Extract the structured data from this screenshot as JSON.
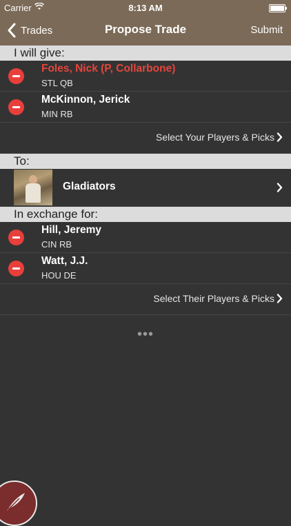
{
  "status": {
    "carrier": "Carrier",
    "time": "8:13 AM"
  },
  "nav": {
    "back_label": "Trades",
    "title": "Propose Trade",
    "submit_label": "Submit"
  },
  "give": {
    "header": "I will give:",
    "players": [
      {
        "name": "Foles, Nick (P, Collarbone)",
        "team": "STL QB",
        "injured": true
      },
      {
        "name": "McKinnon, Jerick",
        "team": "MIN RB",
        "injured": false
      }
    ],
    "select_label": "Select Your Players & Picks"
  },
  "to": {
    "header": "To:",
    "team_name": "Gladiators"
  },
  "exchange": {
    "header": "In exchange for:",
    "players": [
      {
        "name": "Hill, Jeremy",
        "team": "CIN RB"
      },
      {
        "name": "Watt, J.J.",
        "team": "HOU DE"
      }
    ],
    "select_label": "Select Their Players & Picks"
  },
  "more": "•••",
  "colors": {
    "nav_bg": "#7b6a57",
    "body_bg": "#333333",
    "remove": "#e93f3b",
    "injured": "#e6453c",
    "header_bg": "#dcdcdc"
  }
}
